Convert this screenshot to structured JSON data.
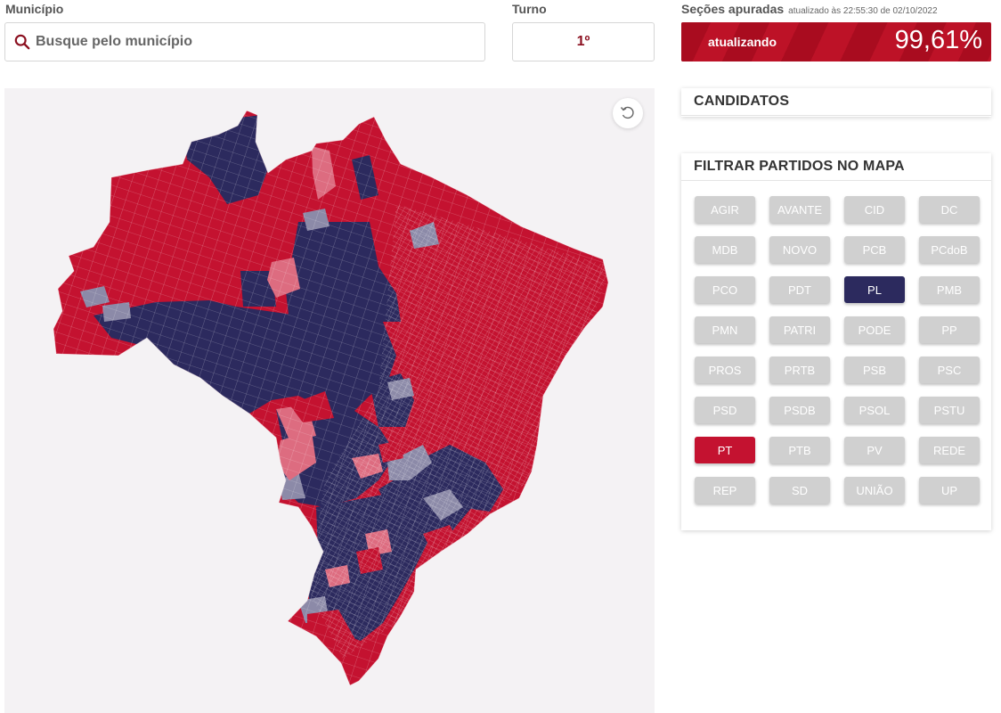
{
  "search": {
    "label": "Município",
    "placeholder": "Busque pelo município",
    "value": ""
  },
  "turno": {
    "label": "Turno",
    "value": "1º"
  },
  "secoes": {
    "label": "Seções apuradas",
    "updated": "atualizado às 22:55:30 de 02/10/2022",
    "status": "atualizando",
    "percent_text": "99,61%",
    "percent": 99.61
  },
  "candidatos": {
    "title": "CANDIDATOS"
  },
  "filtro": {
    "title": "FILTRAR PARTIDOS NO MAPA",
    "parties": [
      {
        "label": "AGIR",
        "active": false
      },
      {
        "label": "AVANTE",
        "active": false
      },
      {
        "label": "CID",
        "active": false
      },
      {
        "label": "DC",
        "active": false
      },
      {
        "label": "MDB",
        "active": false
      },
      {
        "label": "NOVO",
        "active": false
      },
      {
        "label": "PCB",
        "active": false
      },
      {
        "label": "PCdoB",
        "active": false
      },
      {
        "label": "PCO",
        "active": false
      },
      {
        "label": "PDT",
        "active": false
      },
      {
        "label": "PL",
        "active": true,
        "color": "#2c2a5e"
      },
      {
        "label": "PMB",
        "active": false
      },
      {
        "label": "PMN",
        "active": false
      },
      {
        "label": "PATRI",
        "active": false
      },
      {
        "label": "PODE",
        "active": false
      },
      {
        "label": "PP",
        "active": false
      },
      {
        "label": "PROS",
        "active": false
      },
      {
        "label": "PRTB",
        "active": false
      },
      {
        "label": "PSB",
        "active": false
      },
      {
        "label": "PSC",
        "active": false
      },
      {
        "label": "PSD",
        "active": false
      },
      {
        "label": "PSDB",
        "active": false
      },
      {
        "label": "PSOL",
        "active": false
      },
      {
        "label": "PSTU",
        "active": false
      },
      {
        "label": "PT",
        "active": true,
        "color": "#c41230"
      },
      {
        "label": "PTB",
        "active": false
      },
      {
        "label": "PV",
        "active": false
      },
      {
        "label": "REDE",
        "active": false
      },
      {
        "label": "REP",
        "active": false
      },
      {
        "label": "SD",
        "active": false
      },
      {
        "label": "UNIÃO",
        "active": false
      },
      {
        "label": "UP",
        "active": false
      }
    ]
  },
  "map": {
    "colors": {
      "pt_strong": "#c41230",
      "pt_light": "#dd6c80",
      "pl_strong": "#2c2a5e",
      "pl_light": "#8c8aa8",
      "background": "#f4f2f4",
      "inactive_chip": "#d0d0d0"
    },
    "reset_icon": "rotate-ccw-icon"
  }
}
